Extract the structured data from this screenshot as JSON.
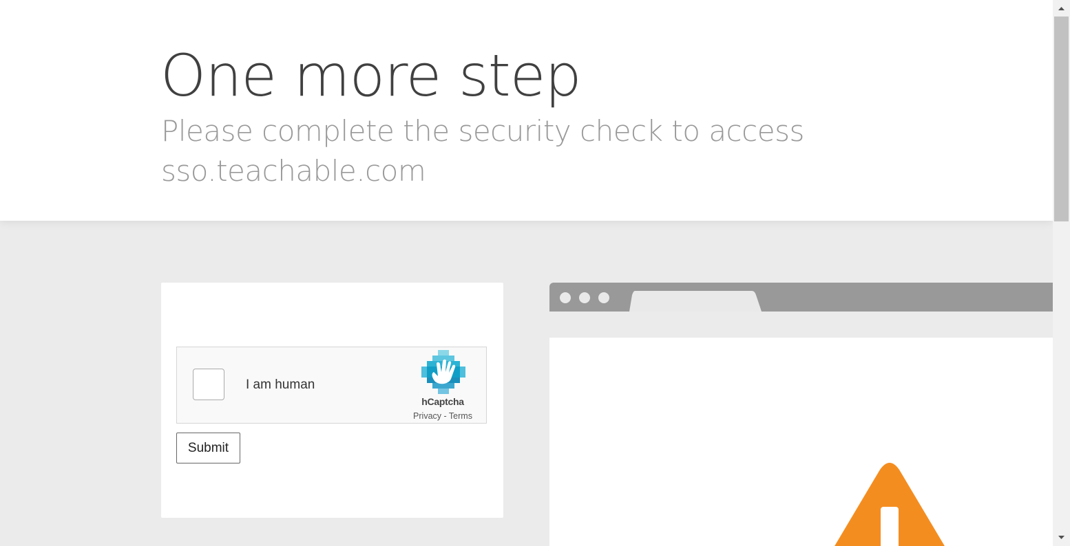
{
  "header": {
    "title": "One more step",
    "subtitle": "Please complete the security check to access sso.teachable.com"
  },
  "captcha": {
    "checkbox_label": "I am human",
    "brand": "hCaptcha",
    "privacy_link": "Privacy",
    "separator": " - ",
    "terms_link": "Terms",
    "checked": false
  },
  "form": {
    "submit_label": "Submit"
  },
  "illustration": {
    "icons": [
      "browser-window-icon",
      "warning-icon"
    ],
    "warning_color": "#f48d20",
    "browser_chrome_color": "#999999"
  },
  "colors": {
    "page_background": "#ebebeb",
    "hcaptcha_brand": "#0096bf"
  }
}
